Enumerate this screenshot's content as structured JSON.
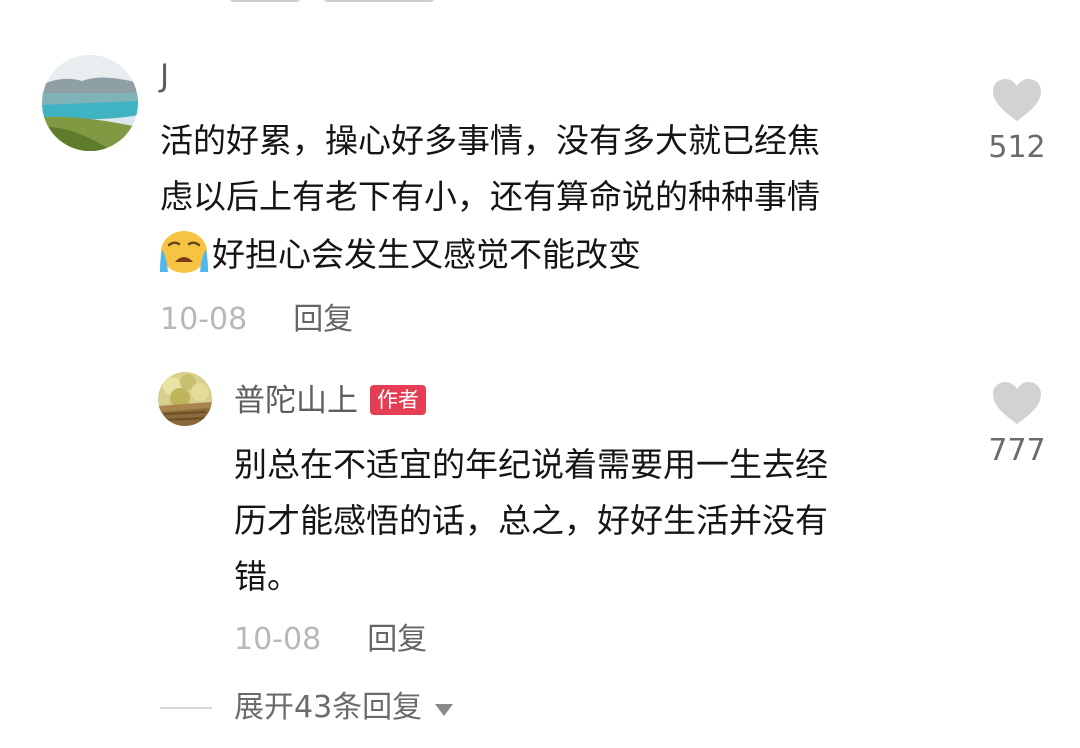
{
  "comment": {
    "username": "J",
    "lines": [
      "活的好累，操心好多事情，没有多大就已经焦",
      "虑以后上有老下有小，还有算命说的种种事情",
      "好担心会发生又感觉不能改变"
    ],
    "emoji": "crying-face-emoji",
    "date": "10-08",
    "reply_label": "回复",
    "likes": "512"
  },
  "reply": {
    "username": "普陀山上",
    "badge": "作者",
    "badge_color": "#e33e53",
    "lines": [
      "别总在不适宜的年纪说着需要用一生去经",
      "历才能感悟的话，总之，好好生活并没有",
      "错。"
    ],
    "date": "10-08",
    "reply_label": "回复",
    "likes": "777"
  },
  "expand": {
    "label": "展开43条回复",
    "icon": "triangle-down-icon"
  },
  "colors": {
    "like_icon": "#d2d2d2",
    "text": "#151515",
    "meta": "#b8b8b8"
  }
}
